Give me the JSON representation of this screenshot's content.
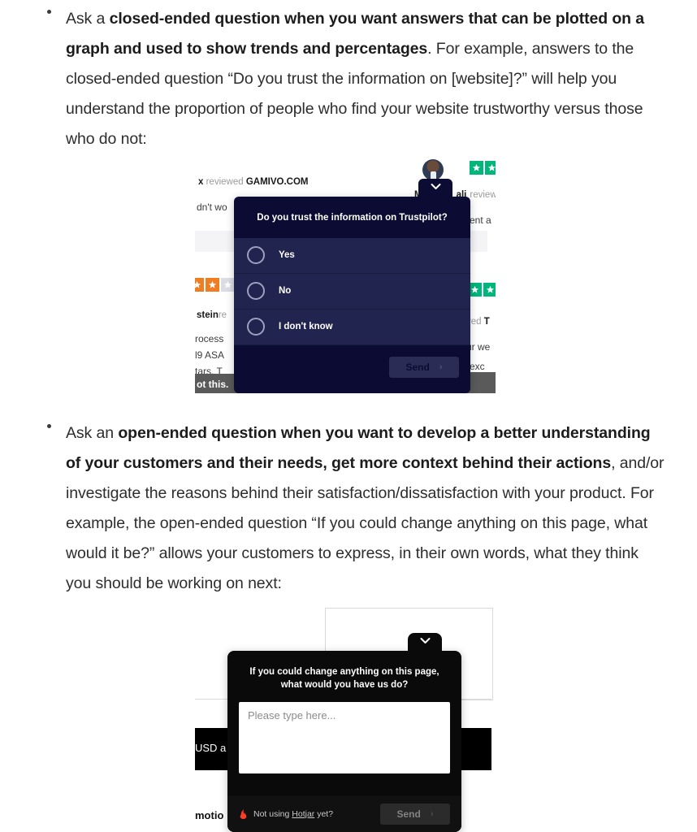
{
  "article": {
    "bullets": [
      {
        "lead": "Ask a ",
        "bold": "closed-ended question when you want answers that can be plotted on a graph and used to show trends and percentages",
        "rest": ". For example, answers to the closed-ended question “Do you trust the information on [website]?” will help you understand the proportion of people who find your website trustworthy versus those who do not:"
      },
      {
        "lead": "Ask an ",
        "bold": "open-ended question when you want to develop a better understanding of your customers and their needs, get more context behind their actions",
        "rest": ", and/or investigate the reasons behind their satisfaction/dissatisfaction with your product. For example, the open-ended question “If you could change anything on this page, what would it be?” allows your customers to express, in their own words, what they think you should be working on next:"
      }
    ]
  },
  "figure_1": {
    "background": {
      "review_line_1_prefix": "x ",
      "review_line_1_muted": "reviewed ",
      "review_line_1_brand": "GAMIVO.COM",
      "review_line_2": "dn't wo",
      "review_line_3_name": "stein",
      "review_line_3_muted": "re",
      "review_line_4": "rocess",
      "review_line_5": "l9 ASA",
      "review_line_6": "tars. T",
      "review_line_7": "ot this.",
      "right_name": "M",
      "right_name_2": "ali",
      "right_muted": "review",
      "right_line_2": "ent a",
      "right_line_3_muted": "ved ",
      "right_line_3_bold": "T",
      "right_line_4": "ur we",
      "right_line_5": "exc"
    },
    "widget": {
      "question": "Do you trust the information on Trustpilot?",
      "options": [
        {
          "label": "Yes"
        },
        {
          "label": "No"
        },
        {
          "label": "I don't know"
        }
      ],
      "send_label": "Send",
      "send_chevron": "›",
      "colors": {
        "header_bg": "#0b0b33",
        "option_bg": "#222450",
        "send_bg": "#2a2c55",
        "text": "#ffffff"
      }
    }
  },
  "figure_2": {
    "background": {
      "line_1": "USD a",
      "line_2": "motio"
    },
    "widget": {
      "question": "If you could change anything on this page, what would you have us do?",
      "textarea_placeholder": "Please type here...",
      "textarea_value": "",
      "brand_prefix": "Not using ",
      "brand_name": "Hotjar",
      "brand_suffix": " yet?",
      "send_label": "Send",
      "send_chevron": "›",
      "colors": {
        "widget_bg": "#0a0a0a",
        "footer_bg": "#111111",
        "send_bg": "#2b2b2b",
        "flame": "#ff3c28"
      }
    }
  }
}
